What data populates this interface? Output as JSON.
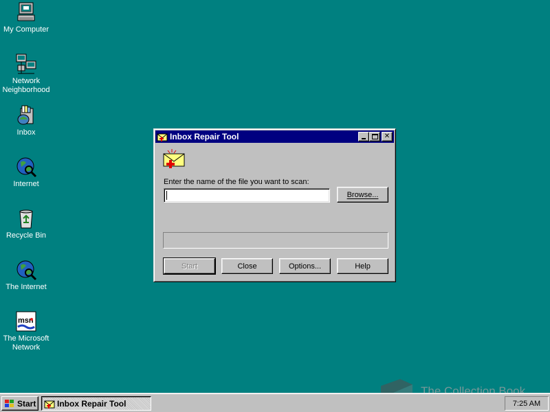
{
  "desktop": {
    "icons": [
      {
        "label": "My Computer",
        "icon": "my-computer-icon"
      },
      {
        "label": "Network",
        "label2": "Neighborhood",
        "icon": "network-neighborhood-icon"
      },
      {
        "label": "Inbox",
        "icon": "inbox-icon"
      },
      {
        "label": "Internet",
        "icon": "internet-icon"
      },
      {
        "label": "Recycle Bin",
        "icon": "recycle-bin-icon"
      },
      {
        "label": "The Internet",
        "icon": "the-internet-icon"
      },
      {
        "label": "The Microsoft",
        "label2": "Network",
        "icon": "msn-icon"
      }
    ]
  },
  "window": {
    "title": "Inbox Repair Tool",
    "prompt": "Enter the name of the file you want to scan:",
    "file_value": "",
    "buttons": {
      "browse": "Browse...",
      "start": "Start",
      "close": "Close",
      "options": "Options...",
      "help": "Help"
    }
  },
  "taskbar": {
    "start_label": "Start",
    "task_label": "Inbox Repair Tool",
    "clock": "7:25 AM"
  },
  "watermark": "The Collection Book",
  "colors": {
    "desktop": "#008080",
    "titlebar": "#000080",
    "face": "#c0c0c0"
  }
}
